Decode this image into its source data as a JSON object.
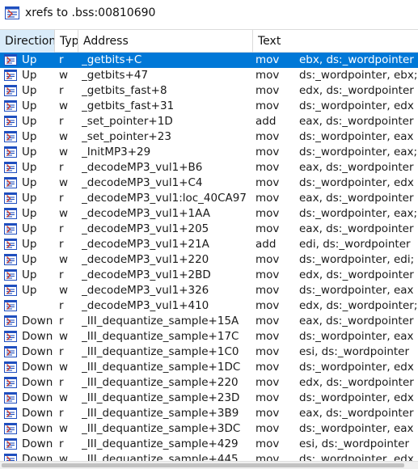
{
  "window": {
    "title": "xrefs to .bss:00810690"
  },
  "columns": [
    {
      "key": "direction",
      "label": "Direction"
    },
    {
      "key": "type",
      "label": "Type"
    },
    {
      "key": "address",
      "label": "Address"
    },
    {
      "key": "text",
      "label": "Text"
    }
  ],
  "selected_index": 0,
  "rows": [
    {
      "direction": "Up",
      "type": "r",
      "address": "_getbits+C",
      "mnemonic": "mov",
      "operands": "ebx, ds:_wordpointer"
    },
    {
      "direction": "Up",
      "type": "w",
      "address": "_getbits+47",
      "mnemonic": "mov",
      "operands": "ds:_wordpointer, ebx; ;"
    },
    {
      "direction": "Up",
      "type": "r",
      "address": "_getbits_fast+8",
      "mnemonic": "mov",
      "operands": "edx, ds:_wordpointer"
    },
    {
      "direction": "Up",
      "type": "w",
      "address": "_getbits_fast+31",
      "mnemonic": "mov",
      "operands": "ds:_wordpointer, edx"
    },
    {
      "direction": "Up",
      "type": "r",
      "address": "_set_pointer+1D",
      "mnemonic": "add",
      "operands": "eax, ds:_wordpointer"
    },
    {
      "direction": "Up",
      "type": "w",
      "address": "_set_pointer+23",
      "mnemonic": "mov",
      "operands": "ds:_wordpointer, eax"
    },
    {
      "direction": "Up",
      "type": "w",
      "address": "_InitMP3+29",
      "mnemonic": "mov",
      "operands": "ds:_wordpointer, eax; ("
    },
    {
      "direction": "Up",
      "type": "r",
      "address": "_decodeMP3_vul1+B6",
      "mnemonic": "mov",
      "operands": "eax, ds:_wordpointer"
    },
    {
      "direction": "Up",
      "type": "w",
      "address": "_decodeMP3_vul1+C4",
      "mnemonic": "mov",
      "operands": "ds:_wordpointer, edx"
    },
    {
      "direction": "Up",
      "type": "r",
      "address": "_decodeMP3_vul1:loc_40CA97",
      "mnemonic": "mov",
      "operands": "eax, ds:_wordpointer"
    },
    {
      "direction": "Up",
      "type": "w",
      "address": "_decodeMP3_vul1+1AA",
      "mnemonic": "mov",
      "operands": "ds:_wordpointer, eax; U"
    },
    {
      "direction": "Up",
      "type": "r",
      "address": "_decodeMP3_vul1+205",
      "mnemonic": "mov",
      "operands": "eax, ds:_wordpointer"
    },
    {
      "direction": "Up",
      "type": "r",
      "address": "_decodeMP3_vul1+21A",
      "mnemonic": "add",
      "operands": "edi, ds:_wordpointer"
    },
    {
      "direction": "Up",
      "type": "w",
      "address": "_decodeMP3_vul1+220",
      "mnemonic": "mov",
      "operands": "ds:_wordpointer, edi; U"
    },
    {
      "direction": "Up",
      "type": "r",
      "address": "_decodeMP3_vul1+2BD",
      "mnemonic": "mov",
      "operands": "edx, ds:_wordpointer"
    },
    {
      "direction": "Up",
      "type": "w",
      "address": "_decodeMP3_vul1+326",
      "mnemonic": "mov",
      "operands": "ds:_wordpointer, eax"
    },
    {
      "direction": "",
      "type": "r",
      "address": "_decodeMP3_vul1+410",
      "mnemonic": "mov",
      "operands": "edx, ds:_wordpointer;"
    },
    {
      "direction": "Down",
      "type": "r",
      "address": "_III_dequantize_sample+15A",
      "mnemonic": "mov",
      "operands": "eax, ds:_wordpointer"
    },
    {
      "direction": "Down",
      "type": "w",
      "address": "_III_dequantize_sample+17C",
      "mnemonic": "mov",
      "operands": "ds:_wordpointer, eax"
    },
    {
      "direction": "Down",
      "type": "r",
      "address": "_III_dequantize_sample+1C0",
      "mnemonic": "mov",
      "operands": "esi, ds:_wordpointer"
    },
    {
      "direction": "Down",
      "type": "w",
      "address": "_III_dequantize_sample+1DC",
      "mnemonic": "mov",
      "operands": "ds:_wordpointer, edx"
    },
    {
      "direction": "Down",
      "type": "r",
      "address": "_III_dequantize_sample+220",
      "mnemonic": "mov",
      "operands": "edx, ds:_wordpointer"
    },
    {
      "direction": "Down",
      "type": "w",
      "address": "_III_dequantize_sample+23D",
      "mnemonic": "mov",
      "operands": "ds:_wordpointer, edx"
    },
    {
      "direction": "Down",
      "type": "r",
      "address": "_III_dequantize_sample+3B9",
      "mnemonic": "mov",
      "operands": "eax, ds:_wordpointer"
    },
    {
      "direction": "Down",
      "type": "w",
      "address": "_III_dequantize_sample+3DC",
      "mnemonic": "mov",
      "operands": "ds:_wordpointer, eax"
    },
    {
      "direction": "Down",
      "type": "r",
      "address": "_III_dequantize_sample+429",
      "mnemonic": "mov",
      "operands": "esi, ds:_wordpointer"
    },
    {
      "direction": "Down",
      "type": "w",
      "address": "_III_dequantize_sample+445",
      "mnemonic": "mov",
      "operands": "ds:_wordpointer, edx"
    }
  ],
  "colors": {
    "selection": "#0078d7",
    "sorted_header": "#d9ebf9",
    "icon_blue": "#1f4fbf",
    "icon_red": "#d23a2a"
  },
  "icons": {
    "title": "xref-list-icon",
    "row": "xref-row-icon"
  }
}
